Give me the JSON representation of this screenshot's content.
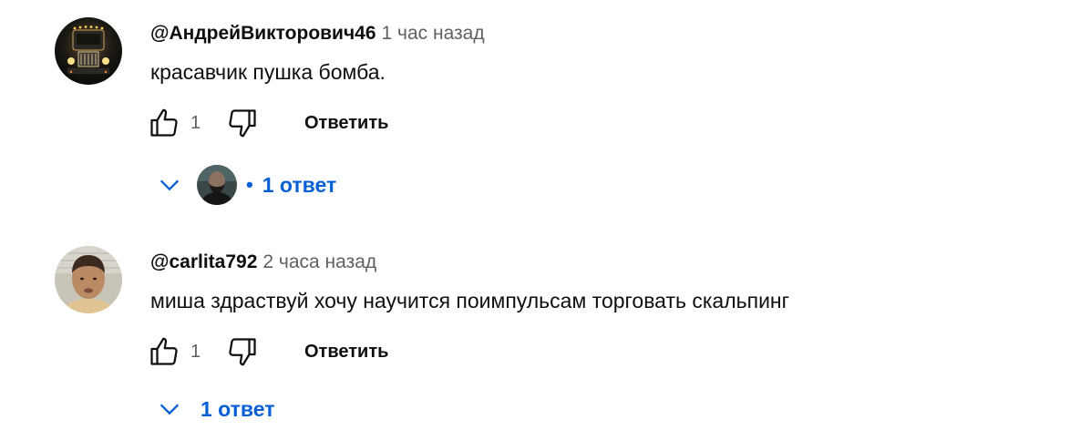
{
  "comments": [
    {
      "author": "@АндрейВикторович46",
      "time": "1 час назад",
      "text": "красавчик пушка бомба.",
      "likes": "1",
      "reply_label": "Ответить",
      "replies_label": "1 ответ",
      "avatar_icon": "truck-avatar",
      "has_reply_avatar": true
    },
    {
      "author": "@carlita792",
      "time": "2 часа назад",
      "text": "миша здраствуй хочу научится поимпульсам торговать скальпинг",
      "likes": "1",
      "reply_label": "Ответить",
      "replies_label": "1 ответ",
      "avatar_icon": "person-avatar",
      "has_reply_avatar": false
    }
  ],
  "colors": {
    "link_blue": "#065fd4",
    "secondary_text": "#606060",
    "primary_text": "#0f0f0f"
  }
}
